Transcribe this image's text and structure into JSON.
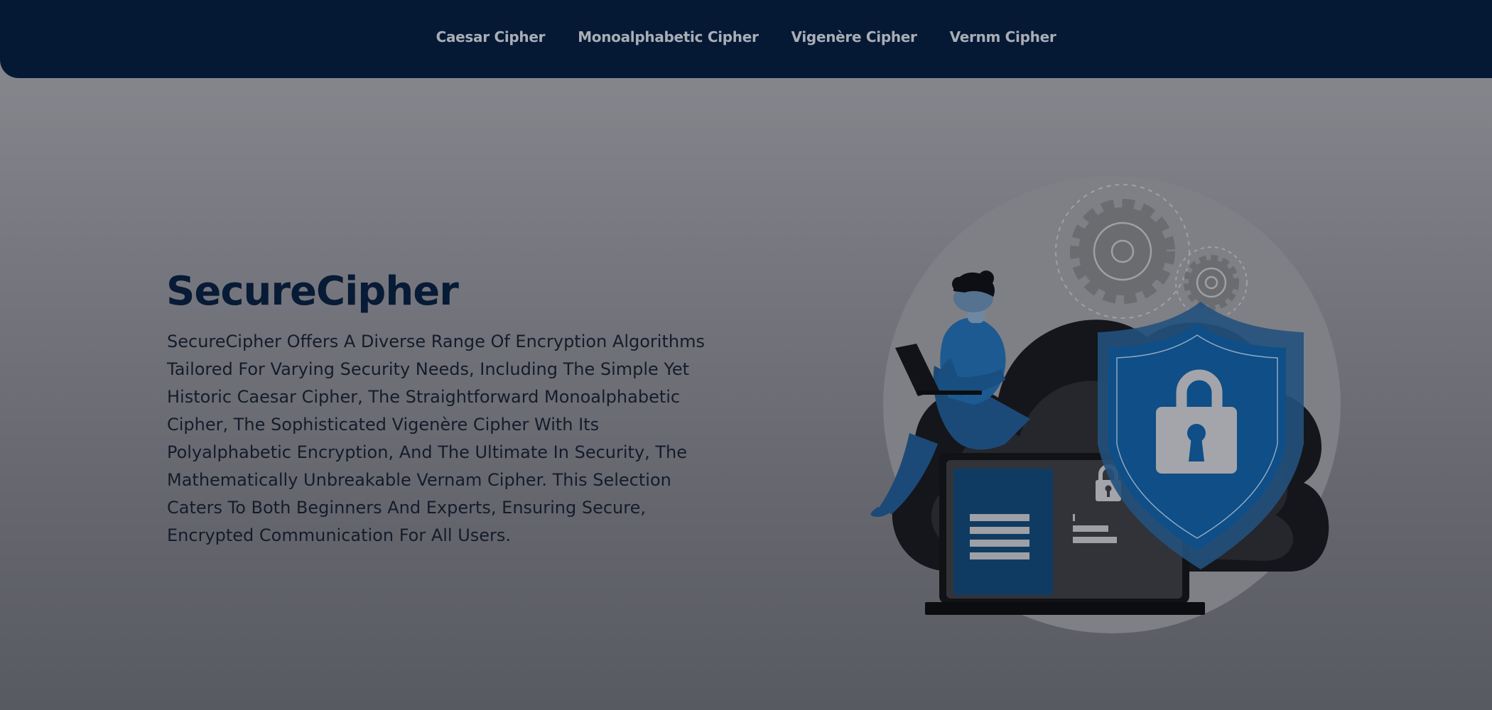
{
  "nav": {
    "items": [
      {
        "label": "Caesar Cipher"
      },
      {
        "label": "Monoalphabetic Cipher"
      },
      {
        "label": "Vigenère Cipher"
      },
      {
        "label": "Vernm Cipher"
      }
    ]
  },
  "hero": {
    "title": "SecureCipher",
    "description": "SecureCipher Offers A Diverse Range Of Encryption Algorithms Tailored For Varying Security Needs, Including The Simple Yet Historic Caesar Cipher, The Straightforward Monoalphabetic Cipher, The Sophisticated Vigenère Cipher With Its Polyalphabetic Encryption, And The Ultimate In Security, The Mathematically Unbreakable Vernam Cipher. This Selection Caters To Both Beginners And Experts, Ensuring Secure, Encrypted Communication For All Users."
  },
  "colors": {
    "navbar_bg": "#061934",
    "nav_text": "#a9adb6",
    "title_text": "#071a36",
    "accent_blue": "#0f4e86"
  }
}
